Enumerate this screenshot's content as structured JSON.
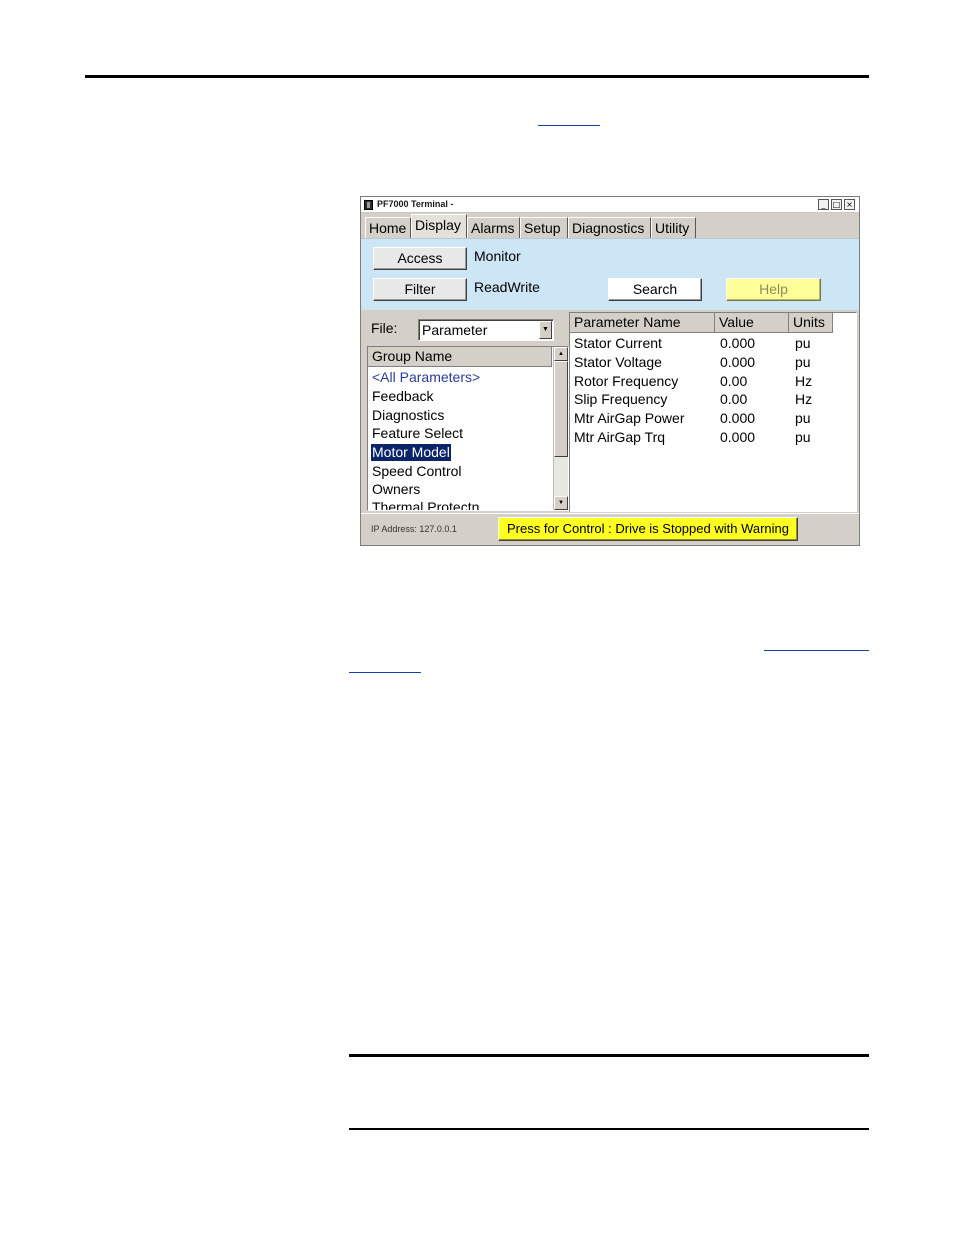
{
  "window": {
    "title": "PF7000 Terminal -",
    "minimize": "_",
    "maximize": "□",
    "close": "×"
  },
  "tabs": [
    "Home",
    "Display",
    "Alarms",
    "Setup",
    "Diagnostics",
    "Utility"
  ],
  "active_tab": "Display",
  "top": {
    "access_button": "Access",
    "access_value": "Monitor",
    "filter_button": "Filter",
    "filter_value": "ReadWrite",
    "search_button": "Search",
    "help_button": "Help"
  },
  "file": {
    "label": "File:",
    "value": "Parameter"
  },
  "group_list": {
    "header": "Group Name",
    "items": [
      "<All Parameters>",
      "Feedback",
      "Diagnostics",
      "Feature Select",
      "Motor Model",
      "Speed Control",
      "Owners",
      "Thermal Protectn"
    ],
    "selected": "Motor Model"
  },
  "param_table": {
    "headers": [
      "Parameter Name",
      "Value",
      "Units"
    ],
    "rows": [
      {
        "name": "Stator Current",
        "value": "0.000",
        "units": "pu"
      },
      {
        "name": "Stator Voltage",
        "value": "0.000",
        "units": "pu"
      },
      {
        "name": "Rotor Frequency",
        "value": "0.00",
        "units": "Hz"
      },
      {
        "name": "Slip Frequency",
        "value": "0.00",
        "units": "Hz"
      },
      {
        "name": "Mtr AirGap Power",
        "value": "0.000",
        "units": "pu"
      },
      {
        "name": "Mtr AirGap Trq",
        "value": "0.000",
        "units": "pu"
      }
    ]
  },
  "status": {
    "ip_address": "IP Address: 127.0.0.1",
    "control_button": "Press for Control : Drive is Stopped with Warning"
  },
  "colors": {
    "top_panel": "#cce6f5",
    "help_button": "#ffff99",
    "control_button": "#ffff22",
    "selection": "#0a246a",
    "link_text": "#2a3c9c"
  }
}
